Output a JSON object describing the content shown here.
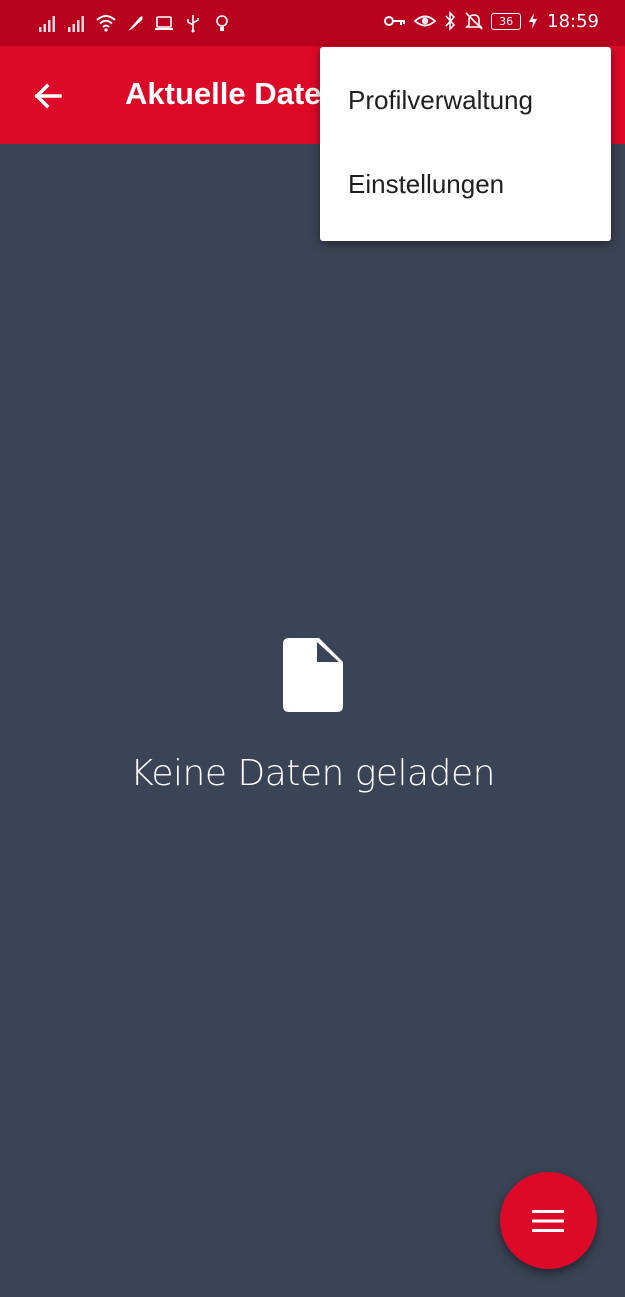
{
  "status_bar": {
    "battery": "36",
    "time": "18:59"
  },
  "app_bar": {
    "title": "Aktuelle Daten",
    "back_icon": "arrow-back-icon"
  },
  "overflow_menu": {
    "items": [
      {
        "label": "Profilverwaltung"
      },
      {
        "label": "Einstellungen"
      }
    ]
  },
  "empty_state": {
    "icon": "document-icon",
    "message": "Keine Daten geladen"
  },
  "fab": {
    "icon": "menu-icon"
  },
  "colors": {
    "status_bar": "#b8001f",
    "app_bar": "#dc0a28",
    "background": "#3b4356",
    "menu_background": "#ffffff",
    "fab": "#dc0a28"
  }
}
